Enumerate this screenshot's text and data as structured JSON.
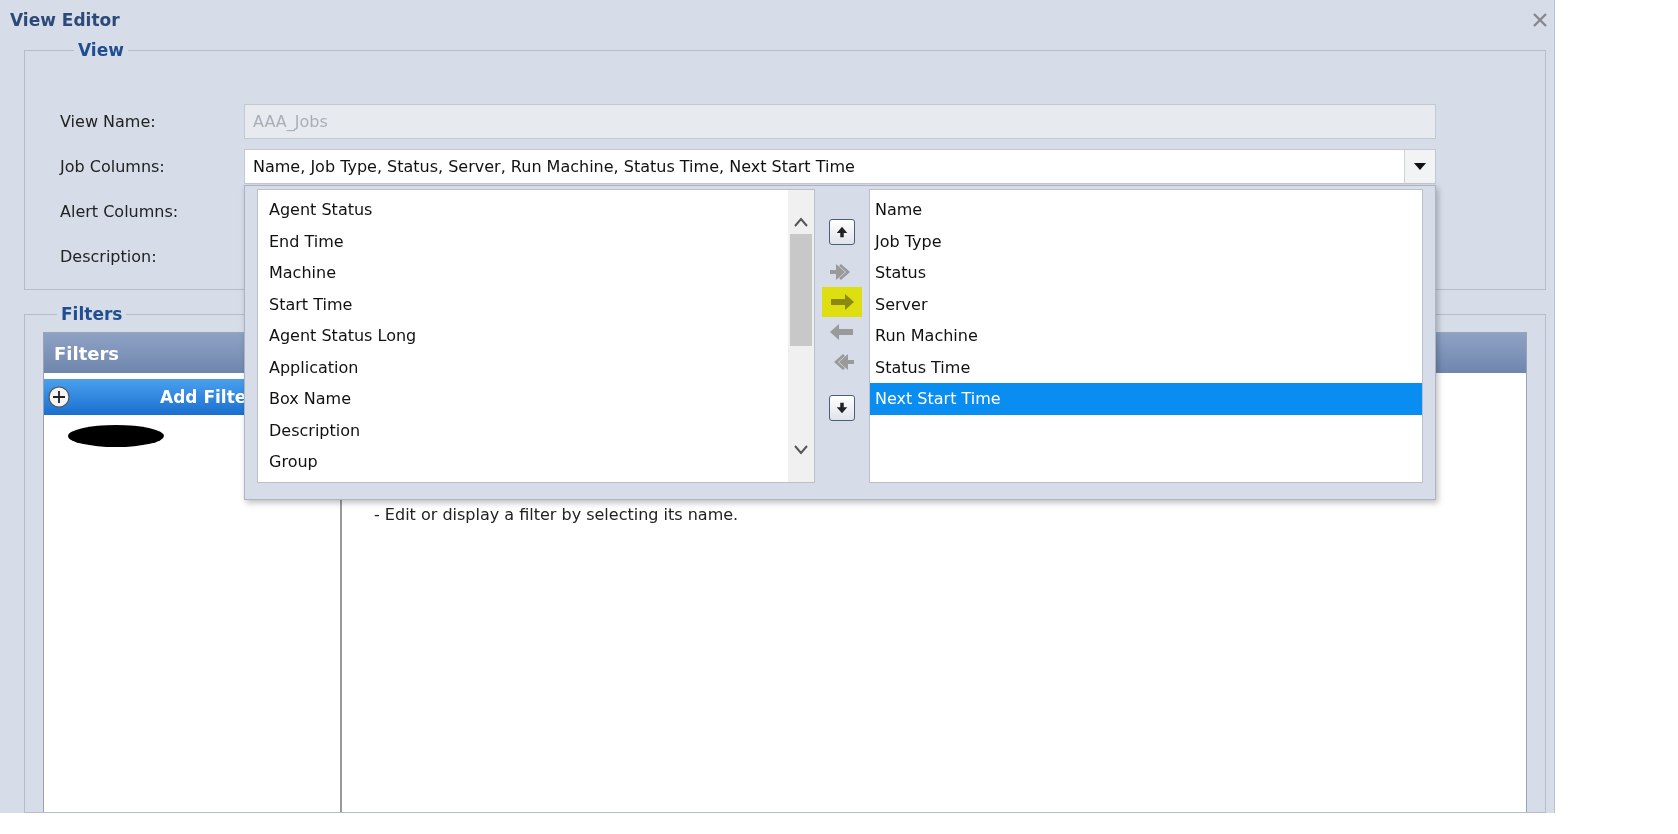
{
  "window": {
    "title": "View Editor"
  },
  "view": {
    "legend": "View",
    "fields": [
      {
        "label": "View Name:",
        "kind": "disabled",
        "value": "AAA_Jobs"
      },
      {
        "label": "Job Columns:",
        "kind": "dropdown",
        "value": "Name, Job Type, Status, Server, Run Machine, Status Time, Next Start Time"
      },
      {
        "label": "Alert Columns:",
        "kind": "covered"
      },
      {
        "label": "Description:",
        "kind": "covered"
      }
    ]
  },
  "column_picker": {
    "available": [
      "Agent Status",
      "End Time",
      "Machine",
      "Start Time",
      "Agent Status Long",
      "Application",
      "Box Name",
      "Description",
      "Group"
    ],
    "transfer_buttons": [
      {
        "kind": "move_up",
        "disabled": false,
        "highlighted": false
      },
      {
        "kind": "add_all",
        "disabled": true,
        "highlighted": false
      },
      {
        "kind": "add",
        "disabled": false,
        "highlighted": true
      },
      {
        "kind": "remove",
        "disabled": true,
        "highlighted": false
      },
      {
        "kind": "remove_all",
        "disabled": true,
        "highlighted": false
      },
      {
        "kind": "move_down",
        "disabled": false,
        "highlighted": false
      }
    ],
    "chosen": [
      {
        "label": "Name",
        "selected": false
      },
      {
        "label": "Job Type",
        "selected": false
      },
      {
        "label": "Status",
        "selected": false
      },
      {
        "label": "Server",
        "selected": false
      },
      {
        "label": "Run Machine",
        "selected": false
      },
      {
        "label": "Status Time",
        "selected": false
      },
      {
        "label": "Next Start Time",
        "selected": true
      }
    ]
  },
  "filters": {
    "legend": "Filters",
    "panel_title": "Filters",
    "add_button": "Add Filte",
    "help_text": "- Edit or display a filter by selecting its name."
  }
}
